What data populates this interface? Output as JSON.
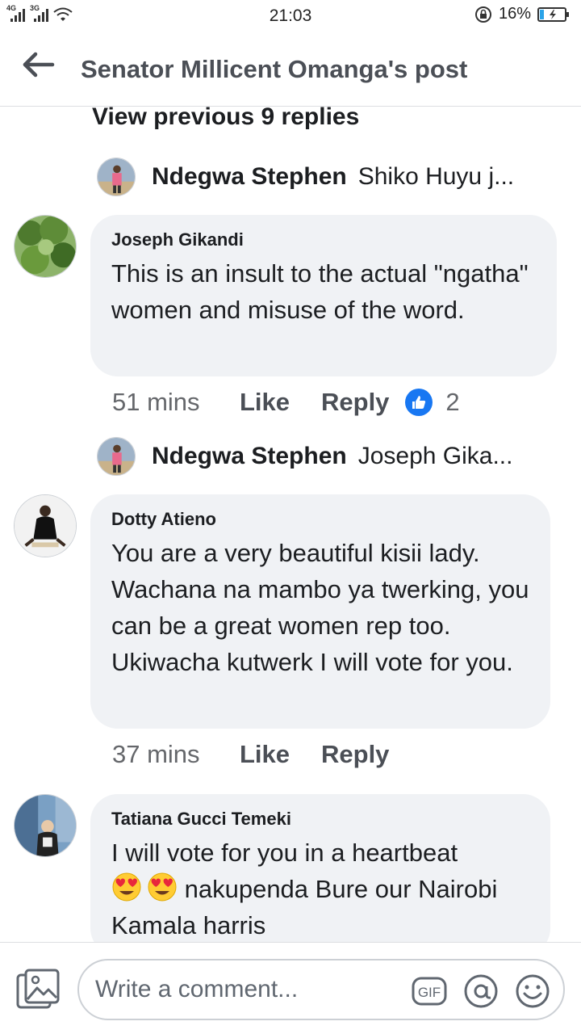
{
  "status_bar": {
    "time": "21:03",
    "network_1": "4G",
    "network_2": "3G",
    "battery": "16%"
  },
  "header": {
    "title": "Senator Millicent Omanga's post"
  },
  "view_previous": "View previous 9 replies",
  "reply_previews": [
    {
      "name": "Ndegwa Stephen",
      "snippet": "Shiko Huyu j..."
    },
    {
      "name": "Ndegwa Stephen",
      "snippet": "Joseph Gika..."
    }
  ],
  "comments": [
    {
      "author": "Joseph Gikandi",
      "text": "This is an insult to the actual \"ngatha\" women and misuse of the word.",
      "time": "51 mins",
      "like": "Like",
      "reply": "Reply",
      "reactions": "2"
    },
    {
      "author": "Dotty Atieno",
      "text": "You are a very beautiful kisii lady. Wachana na mambo ya twerking, you can be a great women rep too. Ukiwacha kutwerk I will vote for you.",
      "time": "37 mins",
      "like": "Like",
      "reply": "Reply"
    },
    {
      "author": "Tatiana Gucci Temeki",
      "text_line1": "I will vote for you in a heartbeat",
      "text_after_emoji": " nakupenda Bure our Nairobi Kamala harris"
    }
  ],
  "composer": {
    "placeholder": "Write a comment...",
    "gif_label": "GIF"
  },
  "icons": [
    "back-arrow-icon",
    "like-icon",
    "heart-eyes-emoji",
    "photo-icon",
    "gif-icon",
    "mention-icon",
    "emoji-icon",
    "wifi-icon",
    "battery-icon",
    "rotation-lock-icon"
  ],
  "colors": {
    "accent": "#1877f2",
    "bubble": "#f0f2f5",
    "secondary_text": "#65676b"
  }
}
